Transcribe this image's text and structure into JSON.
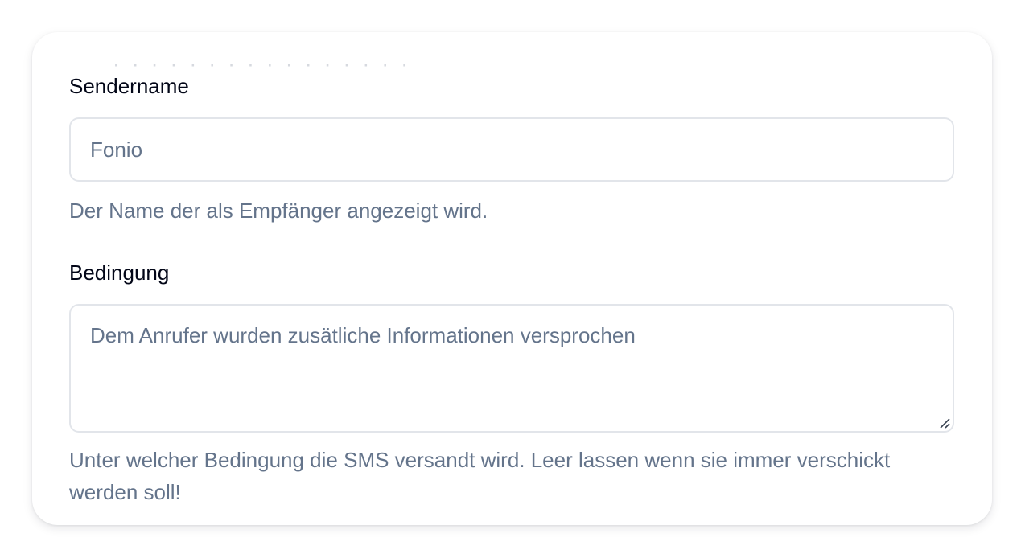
{
  "sender_name": {
    "label": "Sendername",
    "value": "Fonio",
    "help": "Der Name der als Empfänger angezeigt wird."
  },
  "condition": {
    "label": "Bedingung",
    "placeholder": "Dem Anrufer wurden zusätliche Informationen versprochen",
    "help": "Unter welcher Bedingung die SMS versandt wird. Leer lassen wenn sie immer verschickt werden soll!"
  }
}
